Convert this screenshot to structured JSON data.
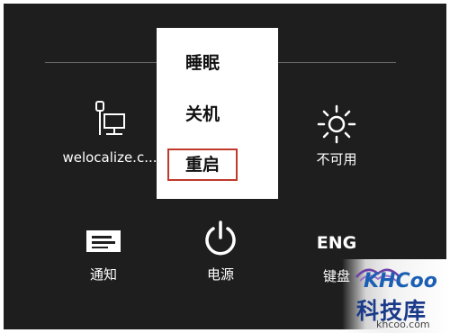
{
  "settings": {
    "network": {
      "label": "welocalize.c...",
      "icon": "network-icon"
    },
    "brightness": {
      "label": "不可用",
      "icon": "brightness-icon"
    },
    "notifications": {
      "label": "通知",
      "icon": "notifications-icon"
    },
    "power": {
      "label": "电源",
      "icon": "power-icon"
    },
    "keyboard": {
      "glyph": "ENG",
      "label": "键盘"
    }
  },
  "power_menu": {
    "items": [
      {
        "label": "睡眠",
        "highlighted": false
      },
      {
        "label": "关机",
        "highlighted": false
      },
      {
        "label": "重启",
        "highlighted": true
      }
    ]
  },
  "colors": {
    "panel_background": "#1e1e1e",
    "menu_background": "#ffffff",
    "highlight_border": "#c0392b"
  },
  "watermark": {
    "logo": "KHCoo",
    "name": "科技库",
    "url": "khcoo.com"
  }
}
